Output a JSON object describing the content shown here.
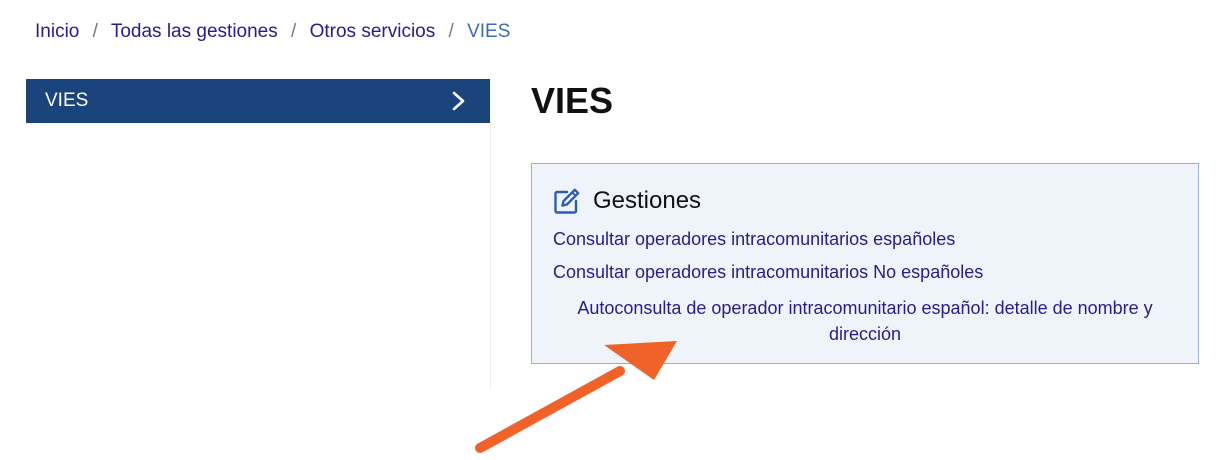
{
  "breadcrumb": {
    "items": [
      "Inicio",
      "Todas las gestiones",
      "Otros servicios"
    ],
    "current": "VIES",
    "separator": "/"
  },
  "sidebar": {
    "items": [
      {
        "label": "VIES",
        "icon": "chevron-right-icon"
      }
    ]
  },
  "main": {
    "title": "VIES",
    "gestiones": {
      "icon": "edit-icon",
      "title": "Gestiones",
      "links": [
        "Consultar operadores intracomunitarios españoles",
        "Consultar operadores intracomunitarios No españoles",
        "Autoconsulta de operador intracomunitario español: detalle de nombre y dirección"
      ]
    }
  },
  "annotation": {
    "icon": "arrow-icon",
    "color": "#f0622a"
  },
  "colors": {
    "link": "#2a1a8c",
    "sidebar_active": "#1b447c",
    "panel_bg": "#eff4fb",
    "panel_border": "#97b1d4"
  }
}
